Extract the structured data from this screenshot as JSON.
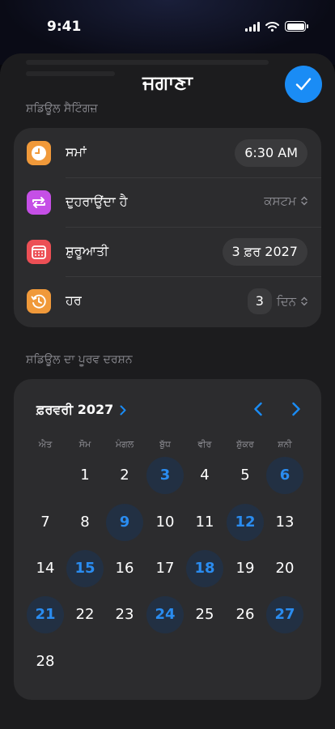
{
  "status_bar": {
    "time": "9:41"
  },
  "header": {
    "title": "ਜਗਾਣਾ"
  },
  "settings": {
    "section_title": "ਸ਼ਡਿਊਲ ਸੈਟਿੰਗਜ਼",
    "time": {
      "label": "ਸਮਾਂ",
      "value": "6:30 AM",
      "icon": "clock-icon",
      "icon_color": "#f0993a"
    },
    "repeat": {
      "label": "ਦੁਹਰਾਉਂਦਾ ਹੈ",
      "value": "ਕਸਟਮ",
      "icon": "repeat-icon",
      "icon_color": "#c54fe6"
    },
    "start": {
      "label": "ਸ਼ੁਰੂਆਤੀ",
      "value": "3 ਫ਼ਰ 2027",
      "icon": "calendar-icon",
      "icon_color": "#ec4f55"
    },
    "every": {
      "label": "ਹਰ",
      "count": "3",
      "unit": "ਦਿਨ",
      "icon": "history-icon",
      "icon_color": "#f0993a"
    }
  },
  "preview": {
    "section_title": "ਸ਼ਡਿਊਲ ਦਾ ਪੂਰਵ ਦਰਸ਼ਨ",
    "month_label": "ਫ਼ਰਵਰੀ 2027",
    "weekdays": [
      "ਐਤ",
      "ਸੋਮ",
      "ਮੰਗਲ",
      "ਬੁੱਧ",
      "ਵੀਰ",
      "ਸ਼ੁੱਕਰ",
      "ਸ਼ਨੀ"
    ],
    "first_weekday_index": 1,
    "days_in_month": 28,
    "selected_days": [
      3,
      6,
      9,
      12,
      15,
      18,
      21,
      24,
      27
    ]
  },
  "colors": {
    "accent": "#1a8cf5",
    "selected_day_bg": "#223043",
    "selected_day_text": "#2a8cf0",
    "card_bg": "#2c2c2e",
    "sheet_bg": "#1c1c1e"
  }
}
